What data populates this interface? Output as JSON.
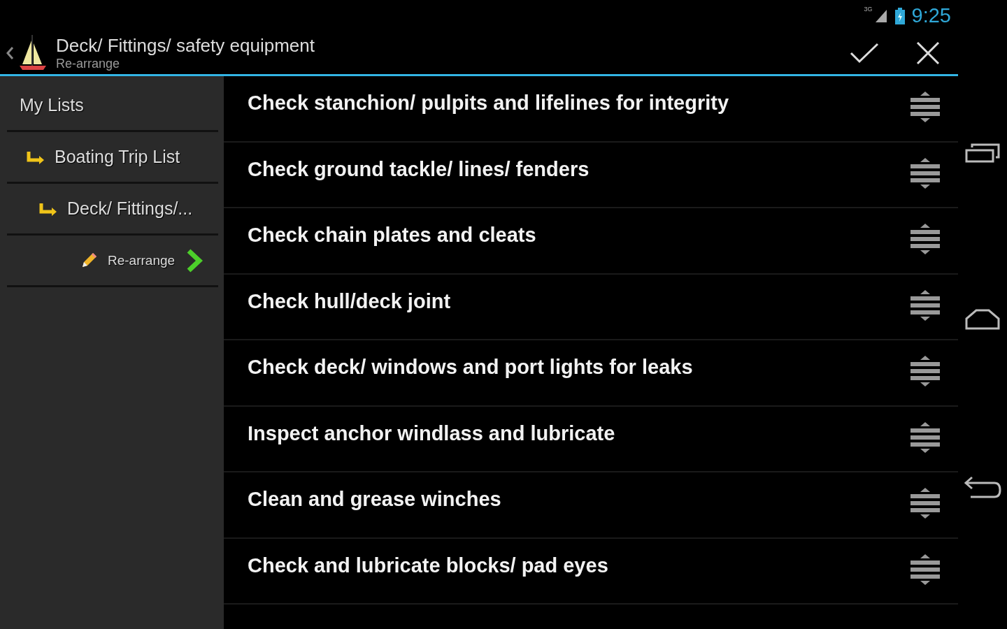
{
  "status_bar": {
    "time": "9:25",
    "network": "3G"
  },
  "action_bar": {
    "title": "Deck/ Fittings/ safety equipment",
    "subtitle": "Re-arrange"
  },
  "sidebar": {
    "items": [
      {
        "label": "My Lists",
        "selected": false,
        "children": [
          {
            "label": "Boating Trip List",
            "selected": false,
            "children": [
              {
                "label": "Deck/ Fittings/...",
                "selected": false,
                "children": [
                  {
                    "label": "Re-arrange",
                    "selected": true
                  }
                ]
              }
            ]
          }
        ]
      }
    ]
  },
  "list": {
    "items": [
      {
        "label": "Check stanchion/ pulpits and lifelines for integrity"
      },
      {
        "label": "Check ground tackle/ lines/ fenders"
      },
      {
        "label": "Check chain plates and cleats"
      },
      {
        "label": "Check hull/deck joint"
      },
      {
        "label": "Check deck/ windows and port lights for leaks"
      },
      {
        "label": "Inspect anchor windlass and lubricate"
      },
      {
        "label": "Clean and grease winches"
      },
      {
        "label": "Check and lubricate blocks/ pad eyes"
      }
    ]
  }
}
